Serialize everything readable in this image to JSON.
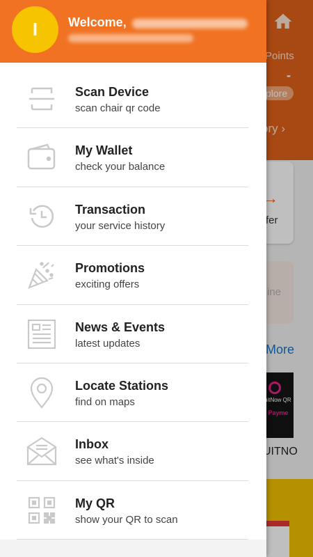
{
  "background": {
    "points_label": "Points",
    "points_value": "-",
    "explore_label": "plore",
    "history_label": "ory",
    "card1_label": "fer",
    "card2_label": "ine",
    "more_label": "More",
    "promo_text1": "uitNow QR",
    "promo_text2": "w Payme",
    "promo_label": "UITNO"
  },
  "drawer": {
    "avatar_initial": "I",
    "welcome": "Welcome,",
    "menu": [
      {
        "title": "Scan Device",
        "subtitle": "scan chair qr code",
        "icon": "scan-icon"
      },
      {
        "title": "My Wallet",
        "subtitle": "check your balance",
        "icon": "wallet-icon"
      },
      {
        "title": "Transaction",
        "subtitle": "your service history",
        "icon": "history-icon"
      },
      {
        "title": "Promotions",
        "subtitle": "exciting offers",
        "icon": "party-popper-icon"
      },
      {
        "title": "News & Events",
        "subtitle": "latest updates",
        "icon": "newspaper-icon"
      },
      {
        "title": "Locate Stations",
        "subtitle": "find on maps",
        "icon": "location-pin-icon"
      },
      {
        "title": "Inbox",
        "subtitle": "see what's inside",
        "icon": "envelope-icon"
      },
      {
        "title": "My QR",
        "subtitle": "show your QR to scan",
        "icon": "qr-code-icon"
      }
    ]
  },
  "colors": {
    "header_orange": "#f07222",
    "avatar_yellow": "#f6c400",
    "icon_gray": "#c9c9c9",
    "link_blue": "#1a73c5"
  }
}
